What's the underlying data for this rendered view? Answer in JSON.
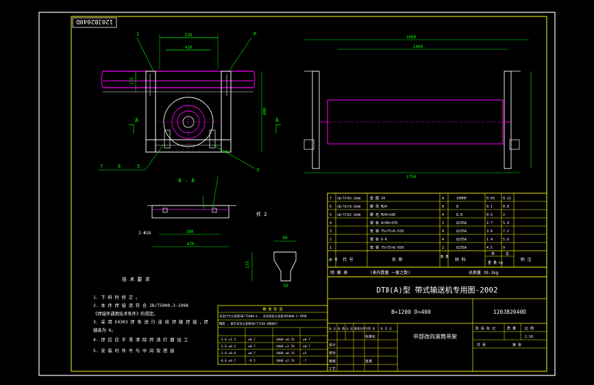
{
  "colors": {
    "background": "#000000",
    "frame": "#ffffff",
    "title_yellow": "#ffff00",
    "geometry_white": "#ffffff",
    "geometry_magenta": "#ff00ff",
    "dimension_green": "#00ff00",
    "outer_backdrop": "#c8ccd2"
  },
  "drawing_number_stamp": "120JB2040D",
  "views": {
    "section_title": "A - A",
    "section_marker_left": "A",
    "section_marker_right": "A",
    "front_dims": {
      "top_width": "520",
      "inner_width": "410",
      "side_height": "400",
      "height_a": "175",
      "side_label_top": "6"
    },
    "balloons": [
      "1",
      "P",
      "7",
      "6",
      "5",
      "4",
      "3"
    ],
    "side_dims": {
      "width": "1600",
      "inner": "1400",
      "overall": "1750"
    },
    "section_dims": {
      "bottom_inner": "380",
      "bottom_overall": "470",
      "bolt": "2-Φ18"
    },
    "piece_label": "件 2",
    "piece_dims": [
      "80",
      "175",
      "50"
    ]
  },
  "tech_notes": {
    "title": "技 术 要 求",
    "items": [
      "1. 下 料 时 修 正 。",
      "2. 本 件 焊 接 须 符 合 JB/T5000.3-1998",
      "  《焊接件通用技术条件》的规定。",
      "3. 采 用 E4303 焊 条 进 行 连 续 焊 缝 焊 接 ，焊",
      "  缝高为 6。",
      "4. 焊 后 应 平 滑 清 除 焊 渣 打 磨 加 工",
      "5. 安 装 时 件 号 与 中 间 架 搭 接"
    ]
  },
  "small_table": {
    "title": "精 度 检 验",
    "note_lines": [
      "未注尺寸公差按GB/T1804-m , 未注形位公差按JB5000.3-1998",
      "精度 , 表示未注公差按GB/T1184-K级执行"
    ],
    "rows": [
      [
        "-2.0 ±1.5",
        "±0.7",
        "-1000 ±0.76",
        "±0.7"
      ],
      [
        "-5.0 ±0.5",
        "±0.7",
        "-1000 ±1.76",
        "±0.7"
      ],
      [
        "-2.0 ±0.6",
        "±0.7",
        "-1000 ±0.76",
        "±5"
      ],
      [
        "-8.0 ±0.7",
        "-9.5",
        "-1000 ±2.76",
        "-7"
      ]
    ]
  },
  "parts_list": {
    "rows": [
      {
        "no": "7",
        "code": "GB/T5783-2000",
        "name": "垫 圈 24",
        "qty": "4",
        "mat": "100HV",
        "w1": "0.03",
        "w2": "0.12"
      },
      {
        "no": "6",
        "code": "GB/T6170-2000",
        "name": "螺 母 M24",
        "qty": "8",
        "mat": "8",
        "w1": "0.1",
        "w2": "0.8"
      },
      {
        "no": "5",
        "code": "GB/T5782-2000",
        "name": "螺 栓 M24×160",
        "qty": "4",
        "mat": "8.8",
        "w1": "0.5",
        "w2": "2"
      },
      {
        "no": "4",
        "code": "",
        "name": "钢 板 8×90×470",
        "qty": "2",
        "mat": "Q235A",
        "w1": "2.7",
        "w2": "5.4"
      },
      {
        "no": "3",
        "code": "",
        "name": "角 钢 75×75×6-520",
        "qty": "4",
        "mat": "Q235A",
        "w1": "3.6",
        "w2": "7.2"
      },
      {
        "no": "2",
        "code": "",
        "name": "钢 板 δ-6",
        "qty": "4",
        "mat": "Q235A",
        "w1": "1.4",
        "w2": "5.6"
      },
      {
        "no": "1",
        "code": "",
        "name": "角 钢 75×75×6-650",
        "qty": "2",
        "mat": "Q235A",
        "w1": "4.5",
        "w2": "9"
      }
    ],
    "header": {
      "no": "序 号",
      "code": "代 号",
      "name": "名 称",
      "qty": "数 量",
      "mat": "材 料",
      "weight_single": "单",
      "weight_total": "总",
      "weight_unit": "重 量 kg",
      "remark": "附 注"
    }
  },
  "summary_row": {
    "label": "明 细 表",
    "note": "(表内数量 一套之数)",
    "total": "总质量 39.1kg"
  },
  "title_block": {
    "title": "DTⅡ(A)型 带式输送机专用图-2002",
    "spec": "B=1200 D=400",
    "drawing_number": "120JB2040D",
    "part_name": "中部改向滚筒吊架",
    "stage_label": "阶 段 标 记",
    "weight_label": "质 量",
    "scale_label": "比 例",
    "scale_value": "1:10",
    "sheet_total": "共 张",
    "sheet_no": "第 张",
    "sign_labels": [
      "标 记",
      "处 数",
      "分 区",
      "更改文件号",
      "签 名",
      "年 月 日"
    ],
    "role_labels": [
      "设计",
      "校对",
      "审核",
      "工艺",
      "标准化",
      "批准"
    ]
  }
}
